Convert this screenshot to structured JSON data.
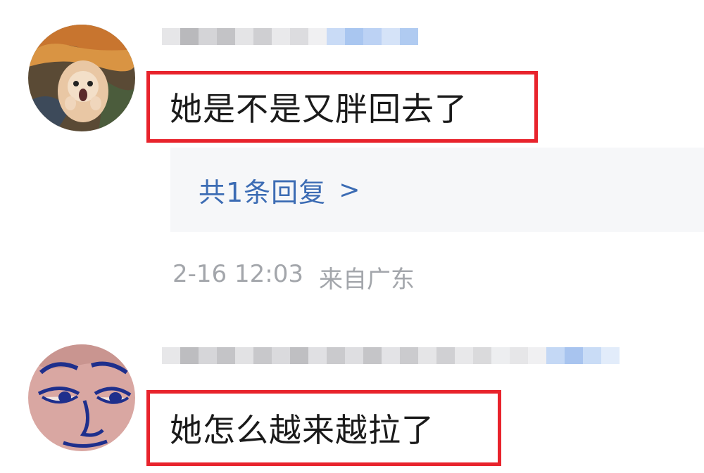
{
  "comments": [
    {
      "text": "她是不是又胖回去了",
      "replies_label": "共1条回复",
      "replies_arrow": ">",
      "time": "2-16 12:03",
      "location": "来自广东",
      "avatar_icon": "hamster-scream-avatar"
    },
    {
      "text": "她怎么越来越拉了",
      "avatar_icon": "blue-line-face-avatar"
    }
  ],
  "colors": {
    "highlight_border": "#e8232c",
    "link": "#3c6cb4",
    "meta": "#a3a6ab",
    "reply_bg": "#f6f7f9"
  }
}
